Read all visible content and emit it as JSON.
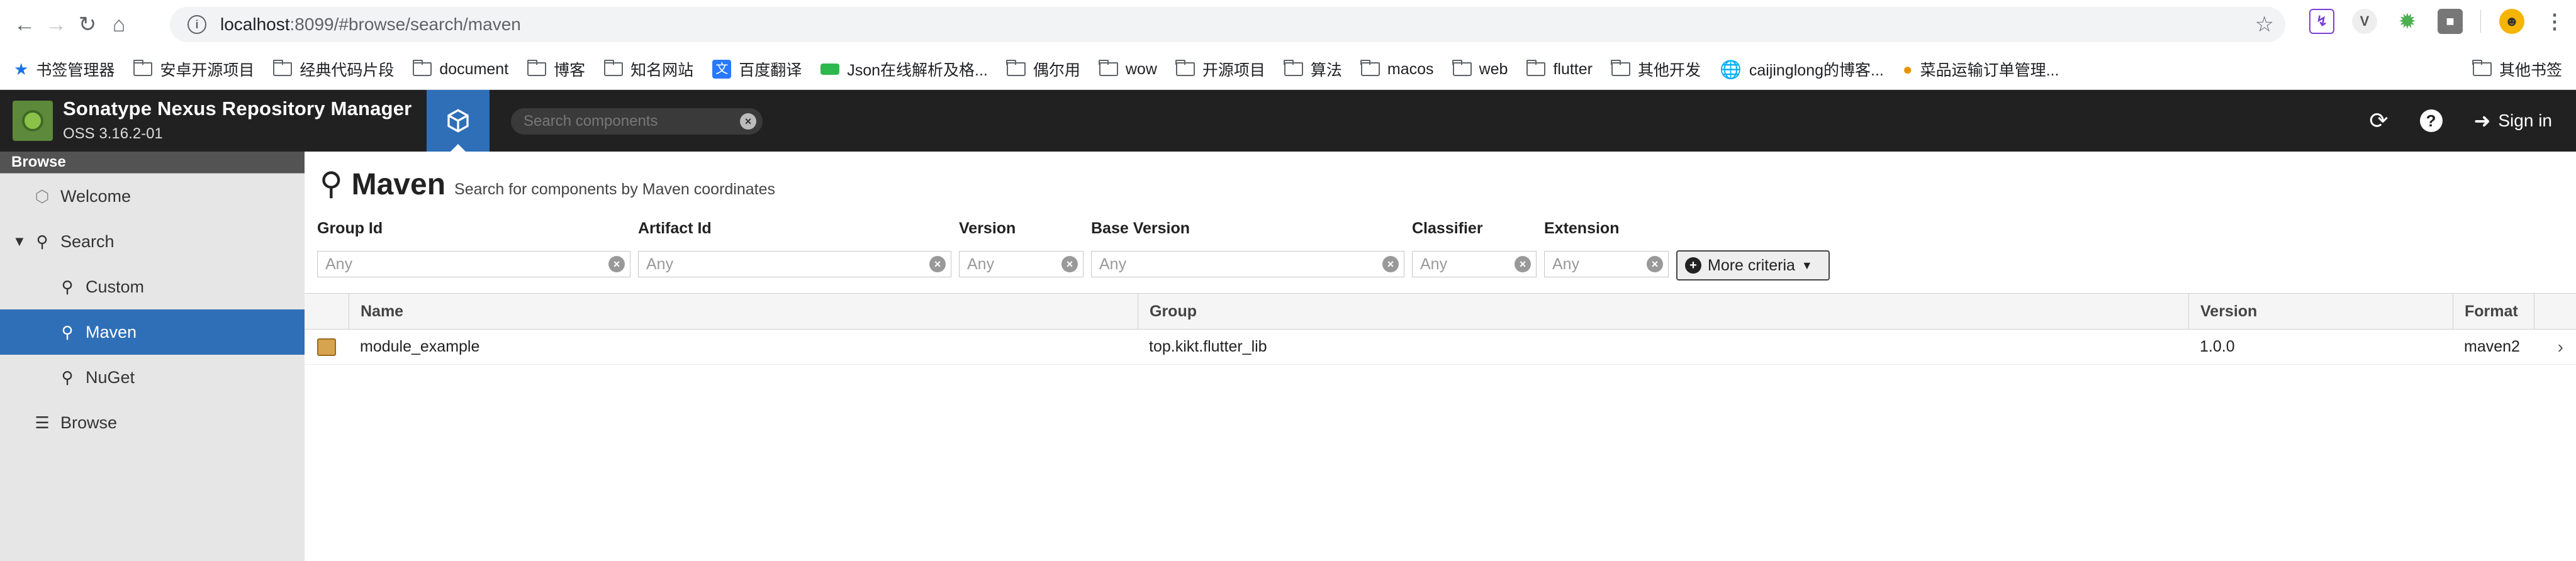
{
  "browser": {
    "url_host": "localhost",
    "url_path": ":8099/#browse/search/maven",
    "bookmarks": [
      {
        "label": "书签管理器",
        "icon": "star-icon"
      },
      {
        "label": "安卓开源项目",
        "icon": "folder-icon"
      },
      {
        "label": "经典代码片段",
        "icon": "folder-icon"
      },
      {
        "label": "document",
        "icon": "folder-icon"
      },
      {
        "label": "博客",
        "icon": "folder-icon"
      },
      {
        "label": "知名网站",
        "icon": "folder-icon"
      },
      {
        "label": "百度翻译",
        "icon": "translate-icon"
      },
      {
        "label": "Json在线解析及格...",
        "icon": "json-icon"
      },
      {
        "label": "偶尔用",
        "icon": "folder-icon"
      },
      {
        "label": "wow",
        "icon": "folder-icon"
      },
      {
        "label": "开源项目",
        "icon": "folder-icon"
      },
      {
        "label": "算法",
        "icon": "folder-icon"
      },
      {
        "label": "macos",
        "icon": "folder-icon"
      },
      {
        "label": "web",
        "icon": "folder-icon"
      },
      {
        "label": "flutter",
        "icon": "folder-icon"
      },
      {
        "label": "其他开发",
        "icon": "folder-icon"
      },
      {
        "label": "caijinglong的博客...",
        "icon": "globe-icon"
      },
      {
        "label": "菜品运输订单管理...",
        "icon": "cart-icon"
      }
    ],
    "other_bookmarks": "其他书签"
  },
  "app": {
    "title": "Sonatype Nexus Repository Manager",
    "version": "OSS 3.16.2-01",
    "search_placeholder": "Search components",
    "sign_in": "Sign in"
  },
  "sidebar": {
    "header": "Browse",
    "items": [
      {
        "label": "Welcome",
        "icon": "hexagon-icon"
      },
      {
        "label": "Search",
        "icon": "search-icon"
      },
      {
        "label": "Custom",
        "icon": "search-icon"
      },
      {
        "label": "Maven",
        "icon": "search-icon"
      },
      {
        "label": "NuGet",
        "icon": "search-icon"
      },
      {
        "label": "Browse",
        "icon": "database-icon"
      }
    ]
  },
  "page": {
    "title": "Maven",
    "subtitle": "Search for components by Maven coordinates"
  },
  "filters": [
    {
      "label": "Group Id",
      "placeholder": "Any"
    },
    {
      "label": "Artifact Id",
      "placeholder": "Any"
    },
    {
      "label": "Version",
      "placeholder": "Any"
    },
    {
      "label": "Base Version",
      "placeholder": "Any"
    },
    {
      "label": "Classifier",
      "placeholder": "Any"
    },
    {
      "label": "Extension",
      "placeholder": "Any"
    }
  ],
  "more_criteria": "More criteria",
  "grid": {
    "columns": [
      "Name",
      "Group",
      "Version",
      "Format"
    ],
    "rows": [
      {
        "name": "module_example",
        "group": "top.kikt.flutter_lib",
        "version": "1.0.0",
        "format": "maven2"
      }
    ]
  },
  "colors": {
    "accent": "#2e6fb8",
    "topbar": "#212121",
    "sidebar": "#e6e6e6"
  }
}
